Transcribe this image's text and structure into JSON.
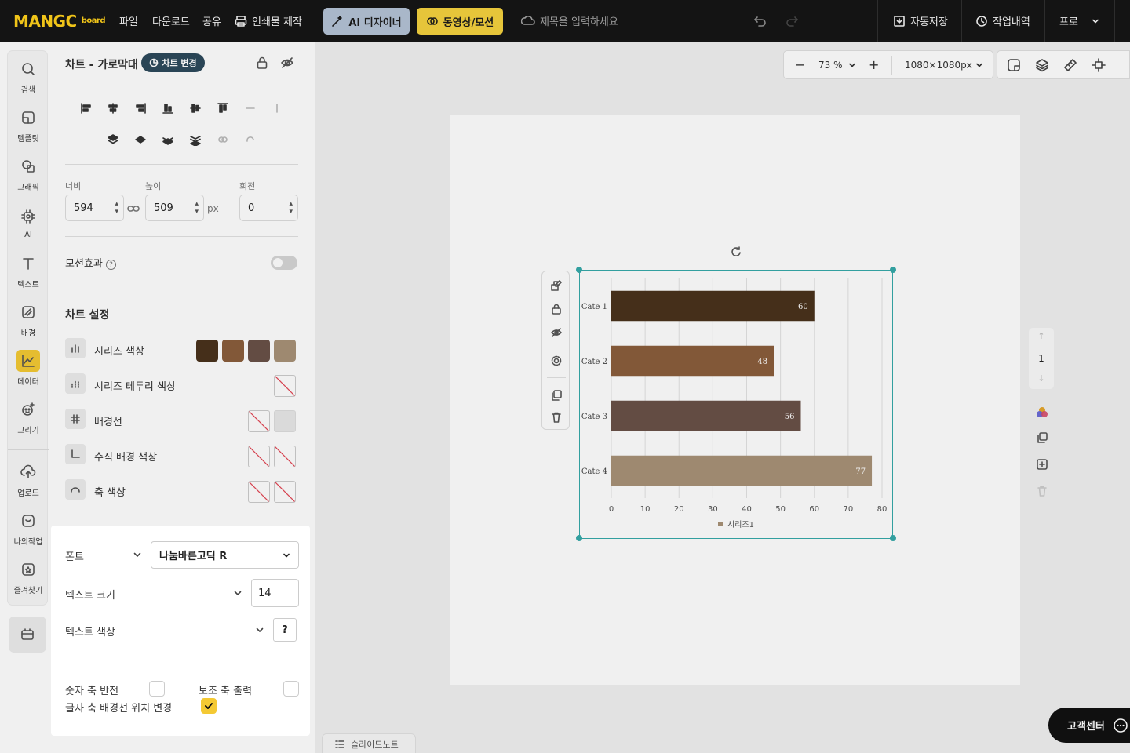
{
  "topbar": {
    "logo": "MANGC",
    "logo_sub": "board",
    "menu": [
      "파일",
      "다운로드",
      "공유"
    ],
    "print_label": "인쇄물 제작",
    "ai_label": "AI 디자이너",
    "video_label": "동영상/모션",
    "title_placeholder": "제목을 입력하세요",
    "autosave_label": "자동저장",
    "history_label": "작업내역",
    "pro_label": "프로",
    "colors": {
      "bg": "#141414",
      "ai_bg": "#a9b7c9",
      "video_bg": "#e6c53a",
      "logo": "#f0c419"
    }
  },
  "rail": {
    "items": [
      {
        "label": "검색",
        "icon": "search-icon"
      },
      {
        "label": "템플릿",
        "icon": "template-icon"
      },
      {
        "label": "그래픽",
        "icon": "graphic-icon"
      },
      {
        "label": "AI",
        "icon": "ai-chip-icon"
      },
      {
        "label": "텍스트",
        "icon": "text-icon"
      },
      {
        "label": "배경",
        "icon": "background-icon"
      },
      {
        "label": "데이터",
        "icon": "chart-line-icon",
        "active": true
      },
      {
        "label": "그리기",
        "icon": "draw-icon"
      },
      {
        "label": "업로드",
        "icon": "upload-icon"
      },
      {
        "label": "나의작업",
        "icon": "my-work-icon"
      },
      {
        "label": "즐겨찾기",
        "icon": "bookmark-icon"
      }
    ]
  },
  "panel": {
    "title": "차트 - 가로막대",
    "change_chart": "차트 변경",
    "width_label": "너비",
    "height_label": "높이",
    "rotation_label": "회전",
    "width": "594",
    "height": "509",
    "unit": "px",
    "rotation": "0",
    "motion_label": "모션효과",
    "motion_help": "?",
    "chart_settings": "차트 설정",
    "series_color": "시리즈 색상",
    "series_border": "시리즈 테두리 색상",
    "gridline": "배경선",
    "vertical_bg": "수직 배경 색상",
    "axis_color": "축 색상",
    "series_swatches": [
      "#4a321c",
      "#8b5e3c",
      "#6a5148",
      "#a89277"
    ]
  },
  "popup": {
    "font_label": "폰트",
    "font_value": "나눔바른고딕 R",
    "size_label": "텍스트 크기",
    "size_value": "14",
    "color_label": "텍스트 색상",
    "color_value": "?",
    "invert_numeric": "숫자 축 반전",
    "secondary_axis": "보조 축 출력",
    "gridline_pos": "글자 축 배경선 위치 변경"
  },
  "workspace": {
    "zoom": "73 %",
    "size": "1080×1080px",
    "page_number": "1",
    "help": "고객센터",
    "slide_note": "슬라이드노트"
  },
  "chart_data": {
    "type": "bar",
    "orientation": "horizontal",
    "categories": [
      "Cate 1",
      "Cate 2",
      "Cate 3",
      "Cate 4"
    ],
    "series": [
      {
        "name": "시리즈1",
        "values": [
          60,
          48,
          56,
          77
        ]
      }
    ],
    "bar_colors": [
      "#4a321c",
      "#8b5e3c",
      "#6a5148",
      "#a89277"
    ],
    "xlim": [
      0,
      80
    ],
    "xticks": [
      0,
      10,
      20,
      30,
      40,
      50,
      60,
      70,
      80
    ],
    "grid": "vertical",
    "legend": "bottom",
    "data_labels": true
  }
}
